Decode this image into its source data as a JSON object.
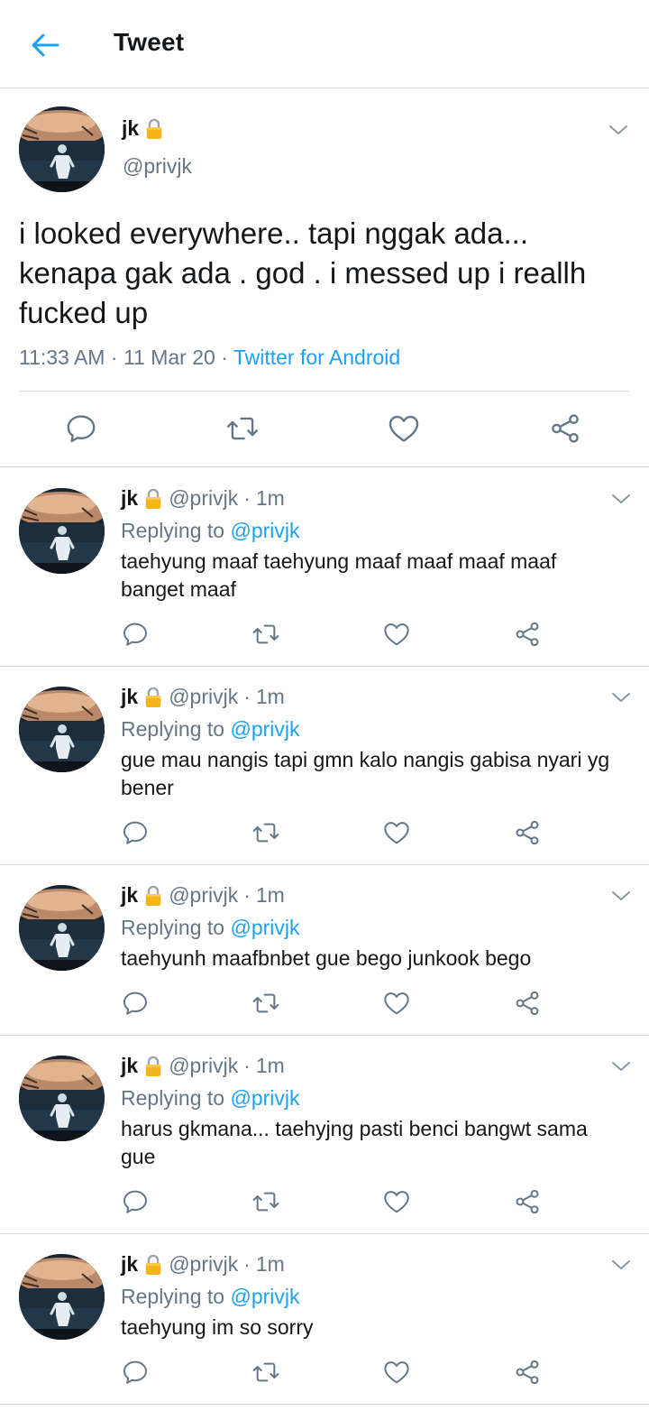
{
  "header": {
    "title": "Tweet"
  },
  "main_tweet": {
    "name": "jk",
    "handle": "@privjk",
    "text": "i looked everywhere.. tapi nggak ada... kenapa gak ada . god . i messed up i reallh fucked up",
    "time": "11:33 AM",
    "date": "11 Mar 20",
    "source": "Twitter for Android"
  },
  "replies": [
    {
      "name": "jk",
      "handle": "@privjk",
      "time": "1m",
      "replying_label": "Replying to",
      "replying_to": "@privjk",
      "text": "taehyung maaf taehyung maaf maaf maaf maaf banget maaf"
    },
    {
      "name": "jk",
      "handle": "@privjk",
      "time": "1m",
      "replying_label": "Replying to",
      "replying_to": "@privjk",
      "text": "gue mau nangis tapi gmn kalo nangis gabisa nyari yg bener"
    },
    {
      "name": "jk",
      "handle": "@privjk",
      "time": "1m",
      "replying_label": "Replying to",
      "replying_to": "@privjk",
      "text": "taehyunh maafbnbet gue bego junkook bego"
    },
    {
      "name": "jk",
      "handle": "@privjk",
      "time": "1m",
      "replying_label": "Replying to",
      "replying_to": "@privjk",
      "text": "harus gkmana... taehyjng pasti benci bangwt sama gue"
    },
    {
      "name": "jk",
      "handle": "@privjk",
      "time": "1m",
      "replying_label": "Replying to",
      "replying_to": "@privjk",
      "text": "taehyung im so sorry"
    }
  ],
  "colors": {
    "accent": "#1da1f2",
    "secondary_text": "#657786",
    "divider": "#d6dde2"
  },
  "icons": [
    "back-arrow-icon",
    "lock-icon",
    "chevron-down-icon",
    "reply-icon",
    "retweet-icon",
    "like-icon",
    "share-icon"
  ]
}
